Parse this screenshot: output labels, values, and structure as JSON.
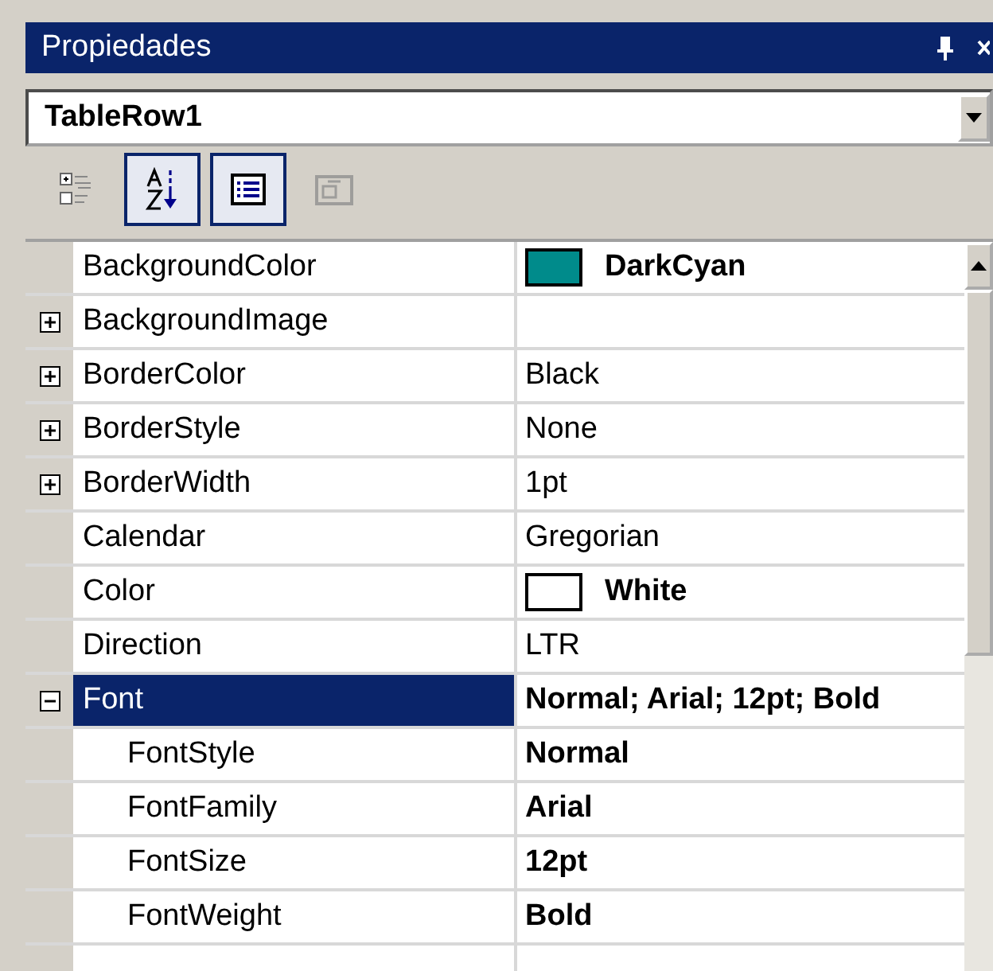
{
  "window": {
    "title": "Propiedades"
  },
  "object_selector": {
    "value": "TableRow1"
  },
  "toolbar": [
    {
      "kind": "categorized",
      "selected": false,
      "disabled": false
    },
    {
      "kind": "alphabetical",
      "selected": true,
      "disabled": false
    },
    {
      "kind": "properties",
      "selected": true,
      "disabled": false
    },
    {
      "kind": "pages",
      "selected": false,
      "disabled": true
    }
  ],
  "properties": [
    {
      "name": "BackgroundColor",
      "value": "DarkCyan",
      "modified": true,
      "color": "#008b8b",
      "kind": "plain",
      "selected": false
    },
    {
      "name": "BackgroundImage",
      "kind": "group",
      "expanded": false,
      "selected": false
    },
    {
      "name": "BorderColor",
      "value": "Black",
      "modified": false,
      "kind": "group",
      "expanded": false,
      "selected": false
    },
    {
      "name": "BorderStyle",
      "value": "None",
      "modified": false,
      "kind": "group",
      "expanded": false,
      "selected": false
    },
    {
      "name": "BorderWidth",
      "value": "1pt",
      "modified": false,
      "kind": "group",
      "expanded": false,
      "selected": false
    },
    {
      "name": "Calendar",
      "value": "Gregorian",
      "modified": false,
      "kind": "plain",
      "selected": false
    },
    {
      "name": "Color",
      "value": "White",
      "modified": true,
      "color": "#ffffff",
      "kind": "plain",
      "selected": false
    },
    {
      "name": "Direction",
      "value": "LTR",
      "modified": false,
      "kind": "plain",
      "selected": false
    },
    {
      "name": "Font",
      "value": "Normal; Arial; 12pt; Bold",
      "modified": true,
      "kind": "group",
      "expanded": true,
      "selected": true,
      "children": [
        {
          "name": "FontStyle",
          "value": "Normal",
          "modified": true,
          "kind": "plain",
          "selected": false
        },
        {
          "name": "FontFamily",
          "value": "Arial",
          "modified": true,
          "kind": "plain",
          "selected": false
        },
        {
          "name": "FontSize",
          "value": "12pt",
          "modified": true,
          "kind": "plain",
          "selected": false
        },
        {
          "name": "FontWeight",
          "value": "Bold",
          "modified": true,
          "kind": "plain",
          "selected": false
        }
      ]
    }
  ]
}
